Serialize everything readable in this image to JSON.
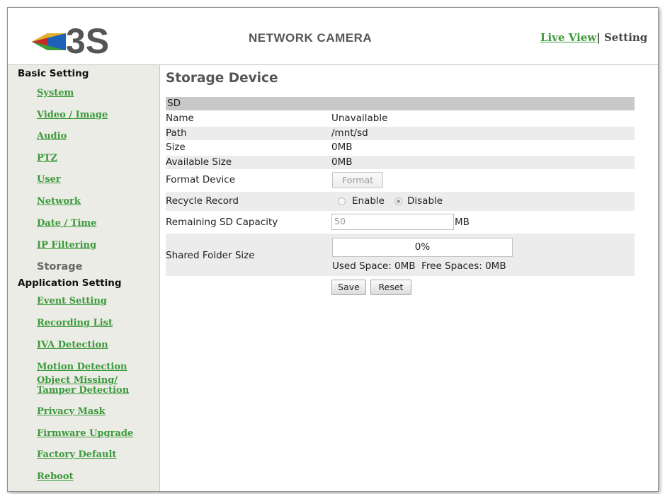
{
  "header": {
    "app_title": "NETWORK CAMERA",
    "nav": {
      "live_view": "Live View",
      "separator": "|",
      "setting": "Setting"
    },
    "logo_text": "3S"
  },
  "sidebar": {
    "basic_title": "Basic Setting",
    "basic_items": [
      "System",
      "Video / Image",
      "Audio",
      "PTZ",
      "User",
      "Network",
      "Date / Time",
      "IP Filtering"
    ],
    "current_item": "Storage",
    "app_title": "Application Setting",
    "app_items": [
      "Event Setting",
      "Recording List",
      "IVA Detection",
      "Motion Detection",
      "Object Missing/",
      "Tamper Detection",
      "Privacy Mask",
      "Firmware Upgrade",
      "Factory Default",
      "Reboot"
    ]
  },
  "main": {
    "title": "Storage Device",
    "section": "SD",
    "rows": {
      "name": {
        "label": "Name",
        "value": "Unavailable"
      },
      "path": {
        "label": "Path",
        "value": "/mnt/sd"
      },
      "size": {
        "label": "Size",
        "value": "0MB"
      },
      "available": {
        "label": "Available Size",
        "value": "0MB"
      }
    },
    "format": {
      "label": "Format Device",
      "button": "Format"
    },
    "recycle": {
      "label": "Recycle Record",
      "enable": "Enable",
      "disable": "Disable",
      "selected": "Disable"
    },
    "remaining": {
      "label": "Remaining SD Capacity",
      "value": "50",
      "unit": "MB"
    },
    "shared": {
      "label": "Shared Folder Size",
      "percent_text": "0%",
      "percent": 0,
      "info": "Used Space: 0MB  Free Spaces: 0MB"
    },
    "save_label": "Save",
    "reset_label": "Reset"
  },
  "colors": {
    "link_green": "#3b9a3b",
    "sidebar_bg": "#ecece6",
    "section_gray": "#c8c8c8"
  },
  "icons": {
    "logo": "3s-logo-icon"
  }
}
